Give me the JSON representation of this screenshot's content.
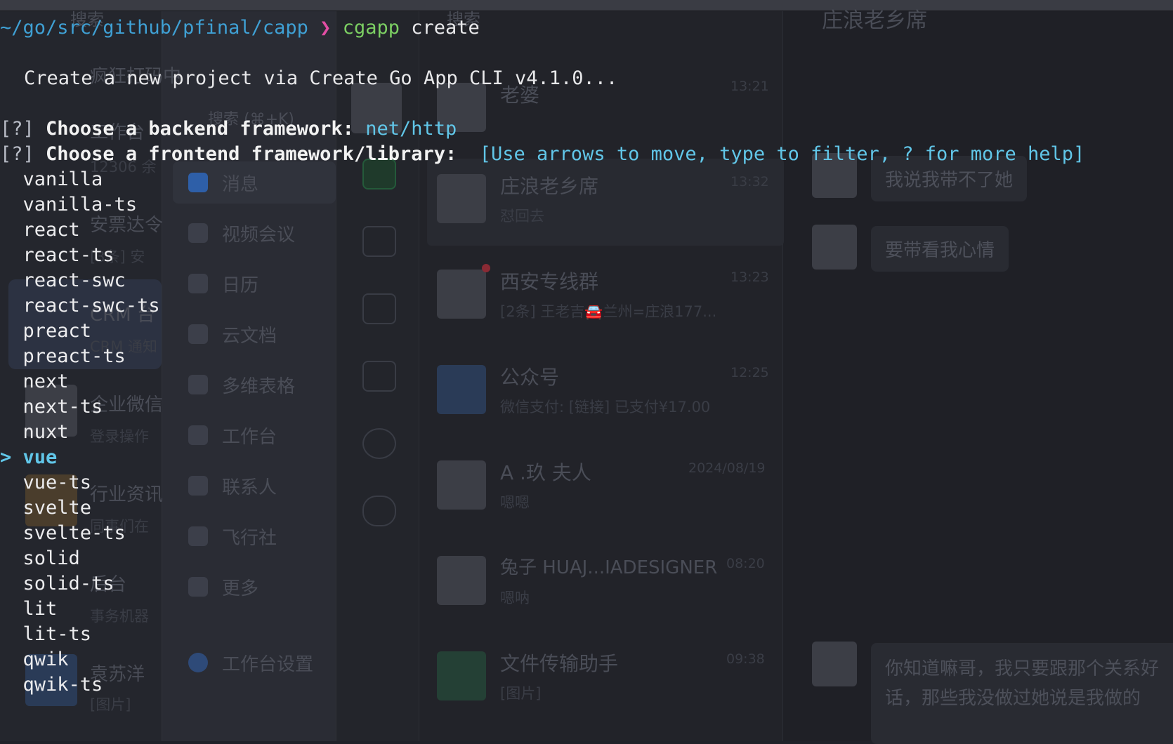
{
  "background_app": {
    "search_label": "搜索",
    "search_shortcut": "搜索 (⌘+K)",
    "chat_title": "庄浪老乡席",
    "nav_items": [
      "消息",
      "视频会议",
      "日历",
      "云文档",
      "多维表格",
      "工作台",
      "联系人",
      "飞行社",
      "更多"
    ],
    "nav_footer": "工作台设置",
    "chats": [
      {
        "name": "老婆",
        "time": "13:21",
        "preview": ""
      },
      {
        "name": "庄浪老乡席",
        "time": "13:32",
        "preview": "怼回去"
      },
      {
        "name": "西安专线群",
        "time": "13:23",
        "preview": "[2条] 王老吉🚘兰州=庄浪177..."
      },
      {
        "name": "公众号",
        "time": "12:25",
        "preview": "微信支付: [链接] 已支付¥17.00"
      },
      {
        "name": "A .玖 夫人",
        "time": "2024/08/19",
        "preview": "嗯嗯"
      },
      {
        "name": "兔子 HUAJ...IADESIGNER",
        "time": "08:20",
        "preview": "嗯呐"
      },
      {
        "name": "文件传输助手",
        "time": "09:38",
        "preview": "[图片]"
      }
    ],
    "messages": [
      "我说我带不了她",
      "要带看我心情",
      "你知道嘛哥，我只要跟那个关系好",
      "话，那些我没做过她说是我做的"
    ],
    "left_list": [
      {
        "name": "疯狂打码中",
        "preview": ""
      },
      {
        "name": "工作台",
        "preview": "12306 余"
      },
      {
        "name": "安票达令",
        "preview": "[3条] 安"
      },
      {
        "name": "CRM 台",
        "preview": "CRM 通知"
      },
      {
        "name": "企业微信",
        "preview": "登录操作"
      },
      {
        "name": "行业资讯",
        "preview": "同事们在"
      },
      {
        "name": "后台",
        "preview": "事务机器"
      },
      {
        "name": "袁苏洋",
        "preview": "[图片]"
      }
    ]
  },
  "terminal": {
    "prompt_path": "~/go/src/github/pfinal/capp",
    "prompt_symbol": "❯",
    "command": "cgapp",
    "command_arg": "create",
    "intro": "Create a new project via Create Go App CLI v4.1.0...",
    "q_marker": "[?]",
    "q1_label": "Choose a backend framework:",
    "q1_answer": "net/http",
    "q2_label": "Choose a frontend framework/library:",
    "q2_hint": "[Use arrows to move, type to filter, ? for more help]",
    "cursor": ">",
    "options": [
      "vanilla",
      "vanilla-ts",
      "react",
      "react-ts",
      "react-swc",
      "react-swc-ts",
      "preact",
      "preact-ts",
      "next",
      "next-ts",
      "nuxt",
      "vue",
      "vue-ts",
      "svelte",
      "svelte-ts",
      "solid",
      "solid-ts",
      "lit",
      "lit-ts",
      "qwik",
      "qwik-ts"
    ],
    "selected_option": "vue"
  }
}
